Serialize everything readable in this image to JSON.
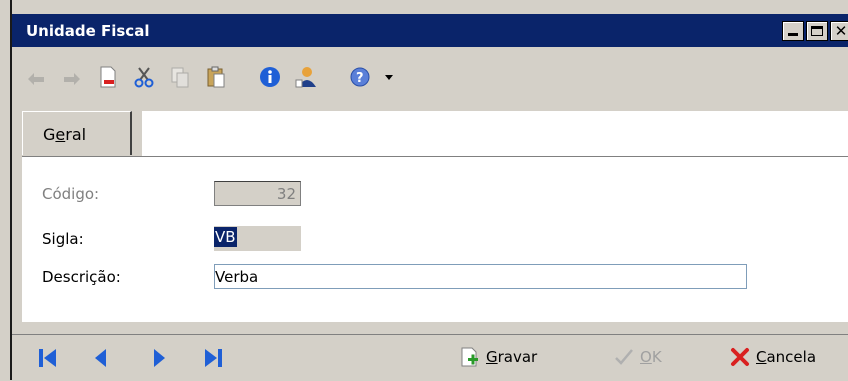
{
  "window": {
    "title": "Unidade Fiscal"
  },
  "toolbar": {
    "icons": [
      "undo-icon",
      "redo-icon",
      "new-document-icon",
      "cut-icon",
      "copy-icon",
      "paste-icon",
      "info-icon",
      "user-icon",
      "help-icon",
      "dropdown-arrow-icon"
    ]
  },
  "tabs": [
    {
      "label_pre": "G",
      "label_ul": "e",
      "label_post": "ral"
    }
  ],
  "form": {
    "codigo": {
      "label": "Código:",
      "value": "32"
    },
    "sigla": {
      "label": "Sigla:",
      "value": "VB"
    },
    "descricao": {
      "label": "Descrição:",
      "value": "Verba"
    }
  },
  "footer": {
    "gravar": {
      "ul": "G",
      "rest": "ravar"
    },
    "ok": {
      "ul": "O",
      "rest": "K"
    },
    "cancela": {
      "ul": "C",
      "rest": "ancela"
    }
  },
  "colors": {
    "titlebar": "#0a246a",
    "background": "#d4d0c8",
    "nav_blue": "#1f5fd6",
    "cancel_red": "#d92020"
  }
}
